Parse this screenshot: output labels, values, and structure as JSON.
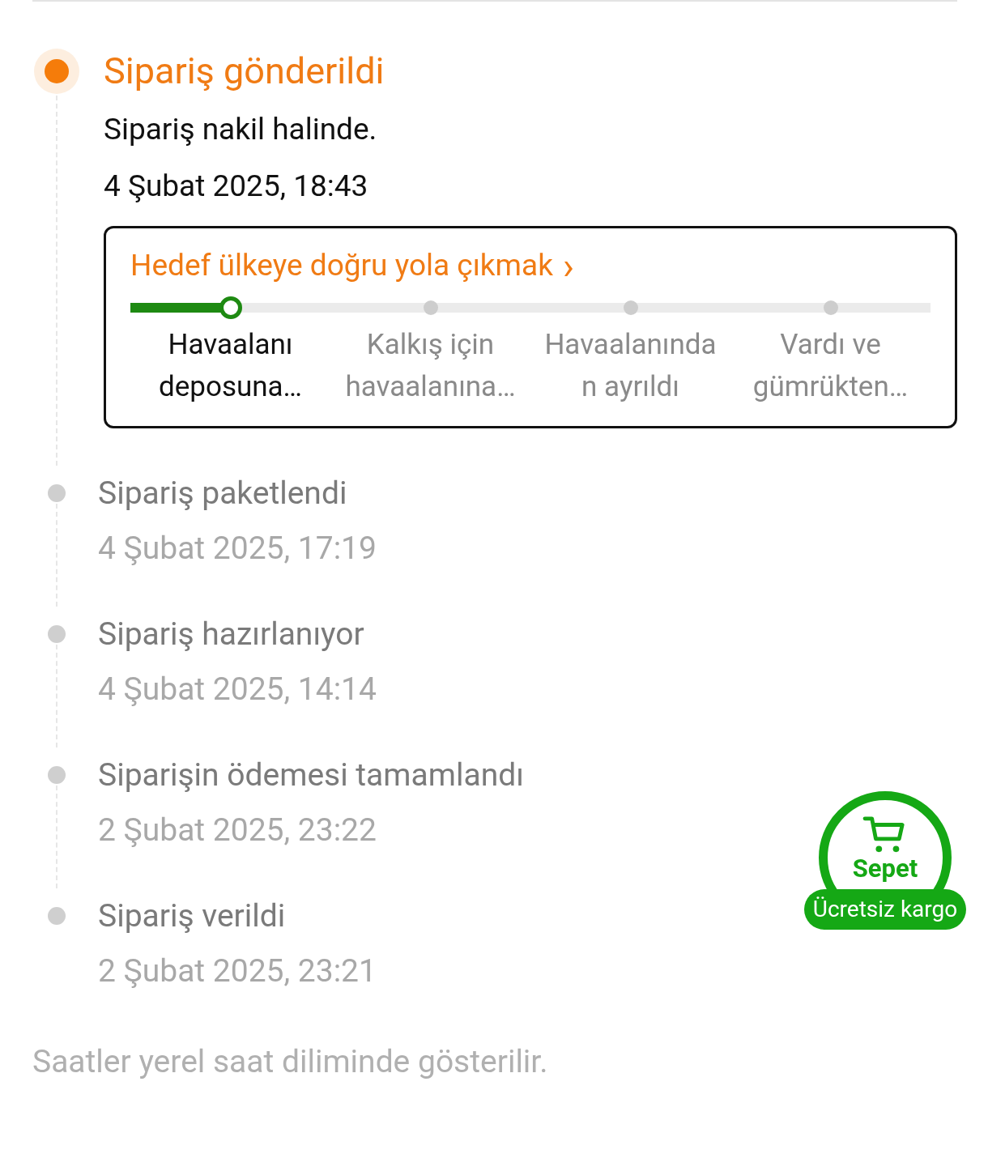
{
  "timeline": [
    {
      "title": "Sipariş gönderildi",
      "current": true,
      "details": [
        "Sipariş nakil halinde.",
        "4 Şubat 2025, 18:43"
      ],
      "tracker": {
        "heading": "Hedef ülkeye doğru yola çıkmak",
        "link_icon": "›",
        "level": 0.125,
        "steps": [
          {
            "label": "Havaalanı deposuna…",
            "reached": true
          },
          {
            "label": "Kalkış için havaalanına…",
            "reached": false
          },
          {
            "label": "Havaalanında n ayrıldı",
            "reached": false
          },
          {
            "label": "Vardı ve gümrükten…",
            "reached": false
          }
        ]
      }
    },
    {
      "title": "Sipariş paketlendi",
      "current": false,
      "details": [
        "4 Şubat 2025, 17:19"
      ]
    },
    {
      "title": "Sipariş hazırlanıyor",
      "current": false,
      "details": [
        "4 Şubat 2025, 14:14"
      ]
    },
    {
      "title": "Siparişin ödemesi tamamlandı",
      "current": false,
      "details": [
        "2 Şubat 2025, 23:22"
      ]
    },
    {
      "title": "Sipariş verildi",
      "current": false,
      "details": [
        "2 Şubat 2025, 23:21"
      ]
    }
  ],
  "footer": "Saatler yerel saat diliminde gösterilir.",
  "cart_badge": {
    "label": "Sepet",
    "ribbon": "Ücretsiz kargo"
  }
}
